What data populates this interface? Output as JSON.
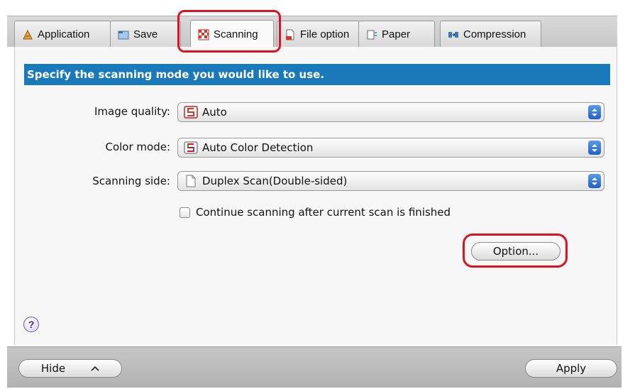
{
  "tabs": [
    {
      "label": "Application",
      "icon": "application-icon"
    },
    {
      "label": "Save",
      "icon": "save-icon"
    },
    {
      "label": "Scanning",
      "icon": "scanning-icon",
      "active": true
    },
    {
      "label": "File option",
      "icon": "file-option-icon"
    },
    {
      "label": "Paper",
      "icon": "paper-icon"
    },
    {
      "label": "Compression",
      "icon": "compression-icon"
    }
  ],
  "banner": {
    "text": "Specify the scanning mode you would like to use."
  },
  "settings": {
    "image_quality": {
      "label": "Image quality:",
      "value": "Auto"
    },
    "color_mode": {
      "label": "Color mode:",
      "value": "Auto Color Detection"
    },
    "scanning_side": {
      "label": "Scanning side:",
      "value": "Duplex Scan(Double-sided)"
    }
  },
  "continue_scanning": {
    "label": "Continue scanning after current scan is finished",
    "checked": false
  },
  "buttons": {
    "option": "Option...",
    "hide": "Hide",
    "apply": "Apply"
  },
  "help": {
    "symbol": "?"
  },
  "colors": {
    "banner": "#1a7ab9",
    "highlight": "#e0121f",
    "popup_arrows": "#1e62c6"
  }
}
